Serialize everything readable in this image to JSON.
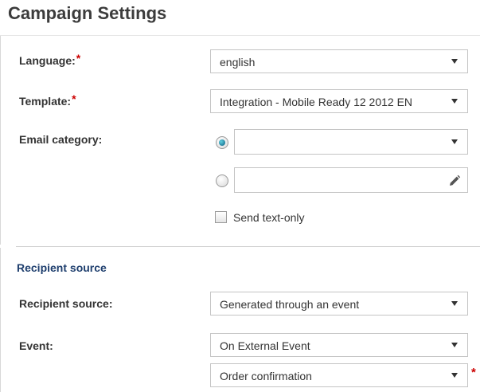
{
  "page": {
    "title": "Campaign Settings"
  },
  "settings": {
    "language": {
      "label": "Language:",
      "value": "english"
    },
    "template": {
      "label": "Template:",
      "value": "Integration - Mobile Ready 12 2012 EN"
    },
    "email_category": {
      "label": "Email category:",
      "select_value": "",
      "text_value": ""
    },
    "text_only": {
      "label": "Send text-only",
      "checked": false
    },
    "required_marker": "*"
  },
  "recipient": {
    "section_title": "Recipient source",
    "source": {
      "label": "Recipient source:",
      "value": "Generated through an event"
    },
    "event": {
      "label": "Event:",
      "value": "On External Event",
      "sub_value": "Order confirmation"
    }
  },
  "icons": {
    "select_caret": "chevron-down-icon",
    "edit": "pencil-icon",
    "required": "asterisk"
  },
  "colors": {
    "required": "#cc0000",
    "section_title": "#1f3f6e",
    "radio_selected": "#0a5c80"
  }
}
